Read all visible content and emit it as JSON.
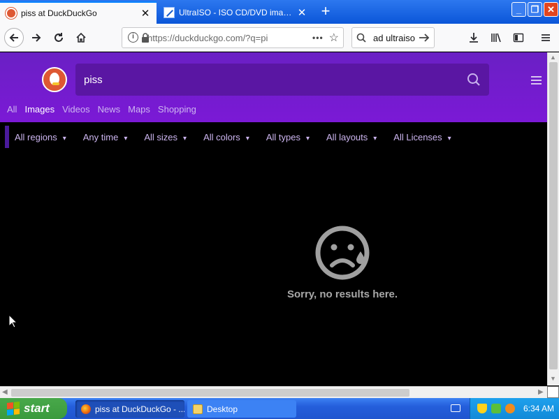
{
  "browser": {
    "tabs": [
      {
        "title": "piss at DuckDuckGo",
        "active": true
      },
      {
        "title": "UltraISO - ISO CD/DVD image creator",
        "active": false
      }
    ],
    "url": "https://duckduckgo.com/?q=pi",
    "search_value": "ad ultraiso"
  },
  "ddg": {
    "query": "piss",
    "tabs": [
      "All",
      "Images",
      "Videos",
      "News",
      "Maps",
      "Shopping"
    ],
    "active_tab": "Images",
    "filters": [
      "All regions",
      "Any time",
      "All sizes",
      "All colors",
      "All types",
      "All layouts",
      "All Licenses"
    ],
    "no_results": "Sorry, no results here.",
    "colors": {
      "header": "#7019d0",
      "accent": "#de5833"
    }
  },
  "taskbar": {
    "start_label": "start",
    "tasks": [
      "piss at DuckDuckGo - ...",
      "Desktop"
    ],
    "clock": "6:34 AM"
  }
}
